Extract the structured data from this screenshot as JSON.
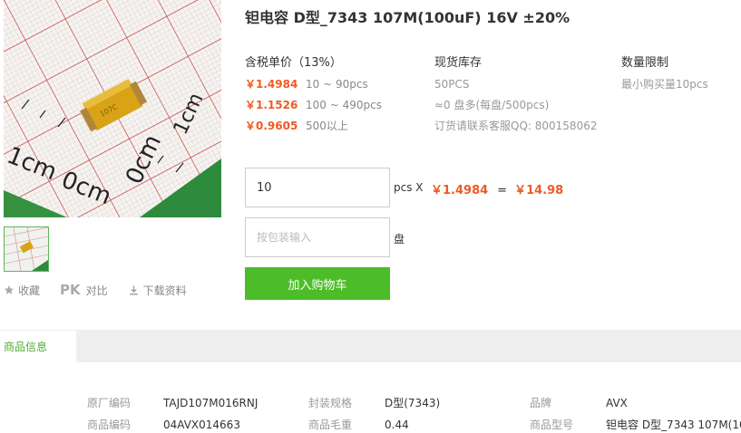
{
  "product": {
    "title": "钽电容 D型_7343 107M(100uF) 16V ±20%"
  },
  "image": {
    "scale_labels": [
      "1cm",
      "0cm"
    ]
  },
  "actions": {
    "favorite": "收藏",
    "pk": "PK",
    "compare": "对比",
    "download": "下载资料"
  },
  "pricing": {
    "header": "含税单价（13%）",
    "tiers": [
      {
        "price": "￥1.4984",
        "range": "10 ~ 90pcs"
      },
      {
        "price": "￥1.1526",
        "range": "100 ~ 490pcs"
      },
      {
        "price": "￥0.9605",
        "range": "500以上"
      }
    ]
  },
  "stock": {
    "header": "现货库存",
    "lines": [
      "50PCS",
      "≈0 盘多(每盘/500pcs)",
      "订货请联系客服QQ: 800158062"
    ]
  },
  "limit": {
    "header": "数量限制",
    "text": "最小购买量10pcs"
  },
  "order": {
    "quantity": "10",
    "quantity_unit": "pcs X",
    "unit_price": "￥1.4984",
    "equals": "=",
    "total": "￥14.98",
    "package_placeholder": "按包装输入",
    "package_unit": "盘",
    "add_to_cart": "加入购物车"
  },
  "tabs": {
    "active": "商品信息"
  },
  "specs": {
    "rows": [
      [
        {
          "label": "原厂编码",
          "value": "TAJD107M016RNJ"
        },
        {
          "label": "封装规格",
          "value": "D型(7343)"
        },
        {
          "label": "品牌",
          "value": "AVX"
        }
      ],
      [
        {
          "label": "商品编码",
          "value": "04AVX014663"
        },
        {
          "label": "商品毛重",
          "value": "0.44"
        },
        {
          "label": "商品型号",
          "value": "钽电容 D型_7343 107M(10."
        }
      ]
    ]
  },
  "colors": {
    "accent_green": "#4cbd29",
    "price_orange": "#f05a23",
    "tab_bar": "#eeeeee"
  }
}
